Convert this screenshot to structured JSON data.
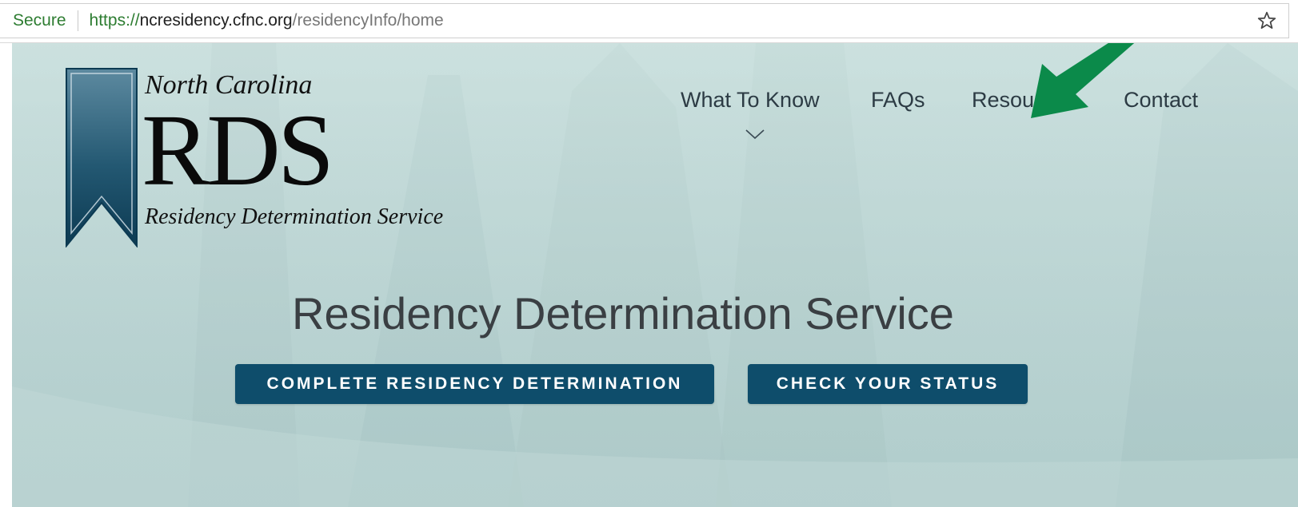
{
  "browser": {
    "secure_label": "Secure",
    "url_scheme": "https://",
    "url_host": "ncresidency.cfnc.org",
    "url_path": "/residencyInfo/home",
    "bookmark_icon": "star-icon"
  },
  "logo": {
    "state": "North Carolina",
    "abbr": "RDS",
    "full_name": "Residency Determination Service",
    "icon": "ribbon-icon"
  },
  "nav": {
    "items": [
      {
        "label": "What To Know",
        "has_dropdown": true
      },
      {
        "label": "FAQs"
      },
      {
        "label": "Resources"
      },
      {
        "label": "Contact"
      }
    ]
  },
  "hero": {
    "title": "Residency Determination Service",
    "primary_button": "COMPLETE RESIDENCY DETERMINATION",
    "secondary_button": "CHECK YOUR STATUS"
  },
  "annotation": {
    "icon": "arrow-icon",
    "color": "#0b8a4a"
  },
  "colors": {
    "button_bg": "#0e4d6b",
    "secure_green": "#2e7d32",
    "background": "#bfd8d6"
  }
}
